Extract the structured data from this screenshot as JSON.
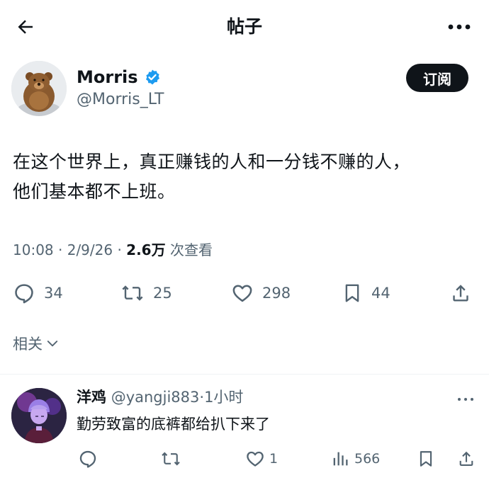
{
  "header": {
    "back_icon": "arrow-left-icon",
    "title": "帖子",
    "more_icon": "more-horizontal-icon"
  },
  "post": {
    "author_name": "Morris",
    "author_verified": true,
    "author_handle": "@Morris_LT",
    "subscribe_label": "订阅",
    "text_line1": "在这个世界上，真正赚钱的人和一分钱不赚的人，",
    "text_line2": "他们基本都不上班。",
    "time": "10:08",
    "date": "2/9/26",
    "views": "2.6万",
    "views_label": "次查看",
    "replies": "34",
    "reposts": "25",
    "likes": "298",
    "bookmarks": "44"
  },
  "related": {
    "label": "相关"
  },
  "reply": {
    "name": "洋鸡",
    "handle": "@yangji883",
    "time": "1小时",
    "text": "勤劳致富的底裤都给扒下来了",
    "likes": "1",
    "views": "566"
  },
  "colors": {
    "text_primary": "#0f1419",
    "text_secondary": "#536471",
    "verified_blue": "#1d9bf0",
    "divider": "#eff3f4"
  }
}
